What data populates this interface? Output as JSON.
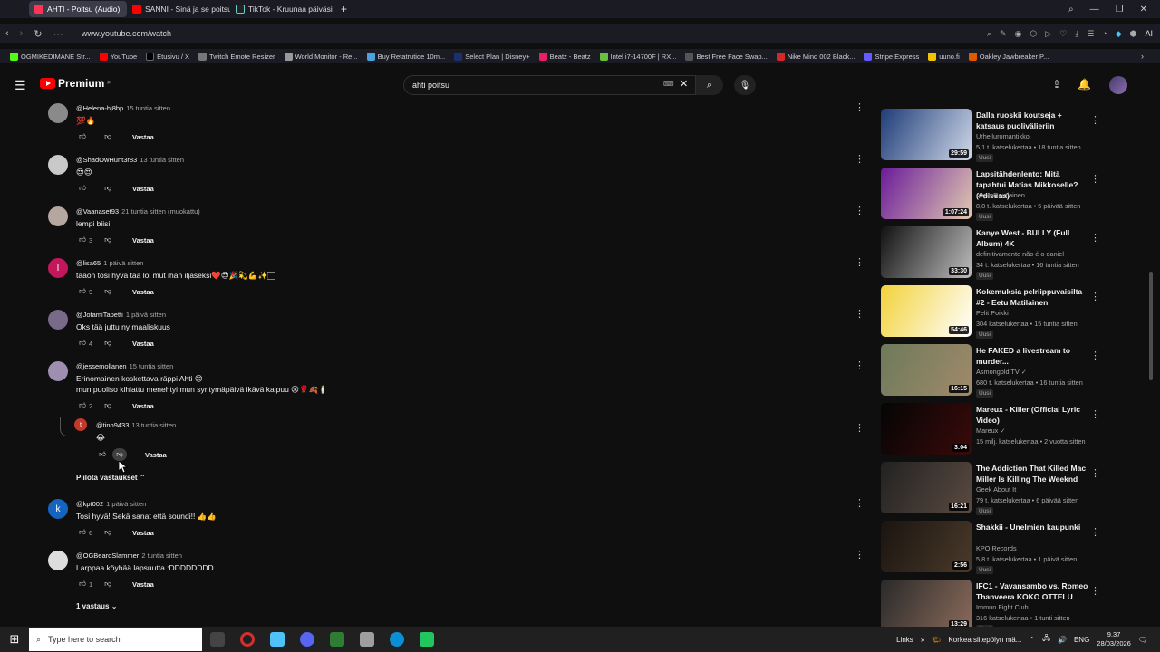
{
  "browser": {
    "tabs": [
      {
        "label": "AHTI - Poitsu (Audio)",
        "color": "#ff3355",
        "active": true
      },
      {
        "label": "SANNI - Sinä ja se poitsu",
        "color": "#ff0000",
        "active": false
      },
      {
        "label": "TikTok - Kruunaa päiväsi",
        "color": "#222222",
        "active": false
      }
    ],
    "new_tab": "+",
    "url": "www.youtube.com/watch",
    "bookmarks": [
      {
        "label": "OGMIKEDIMANE Str...",
        "color": "#53fc18"
      },
      {
        "label": "YouTube",
        "color": "#ff0000"
      },
      {
        "label": "Etusivu / X",
        "color": "#000000"
      },
      {
        "label": "Twitch Emote Resizer",
        "color": "#777777"
      },
      {
        "label": "World Monitor - Re...",
        "color": "#999999"
      },
      {
        "label": "Buy Retatrutide 10m...",
        "color": "#4aa3df"
      },
      {
        "label": "Select Plan | Disney+",
        "color": "#1d2f6f"
      },
      {
        "label": "Beatz - Beatz",
        "color": "#e91e63"
      },
      {
        "label": "Intel i7-14700F | RX...",
        "color": "#6abf40"
      },
      {
        "label": "Best Free Face Swap...",
        "color": "#555555"
      },
      {
        "label": "Nike Mind 002 Black...",
        "color": "#d62828"
      },
      {
        "label": "Stripe Express",
        "color": "#635bff"
      },
      {
        "label": "uuno.fi",
        "color": "#f5c400"
      },
      {
        "label": "Oakley Jawbreaker P...",
        "color": "#e05a00"
      }
    ]
  },
  "youtube": {
    "logo_text": "Premium",
    "logo_sup": "FI",
    "search_value": "ahti poitsu"
  },
  "comments": [
    {
      "author": "@Helena-hj8bp",
      "time": "15 tuntia sitten",
      "text": "💯🔥",
      "likes": "",
      "reply": "Vastaa",
      "avatar": "#8a8a8a",
      "initial": ""
    },
    {
      "author": "@ShadOwHunt3r83",
      "time": "13 tuntia sitten",
      "text": "😍😍",
      "likes": "",
      "reply": "Vastaa",
      "avatar": "#c9c9c9",
      "initial": ""
    },
    {
      "author": "@Vaanaset93",
      "time": "21 tuntia sitten (muokattu)",
      "text": "lempi biisi",
      "likes": "3",
      "reply": "Vastaa",
      "avatar": "#b5a7a0",
      "initial": ""
    },
    {
      "author": "@lisa65",
      "time": "1 päivä sitten",
      "text": "tääon tosi hyvä tää löi mut ihan iljaseksi❤️😍🎉💫💪✨🏻",
      "likes": "9",
      "reply": "Vastaa",
      "avatar": "#c2185b",
      "initial": "l"
    },
    {
      "author": "@JotamiTapetti",
      "time": "1 päivä sitten",
      "text": "Oks tää juttu ny maaliskuus",
      "likes": "4",
      "reply": "Vastaa",
      "avatar": "#7a6a8a",
      "initial": ""
    },
    {
      "author": "@jessemollanen",
      "time": "15 tuntia sitten",
      "text": "Erinomainen koskettava räppi Ahti 😊",
      "text2": "mun puoliso kihlattu menehtyi mun syntymäpäivä ikävä kaipuu 😢🌹🍂🕯️",
      "likes": "2",
      "reply": "Vastaa",
      "avatar": "#9e8fb0",
      "initial": ""
    },
    {
      "author": "@kpt002",
      "time": "1 päivä sitten",
      "text": "Tosi hyvä! Sekä sanat että soundi!! 👍👍",
      "likes": "6",
      "reply": "Vastaa",
      "avatar": "#1565c0",
      "initial": "k"
    },
    {
      "author": "@OGBeardSlammer",
      "time": "2 tuntia sitten",
      "text": "Larppaa köyhää lapsuutta :DDDDDDDD",
      "likes": "1",
      "reply": "Vastaa",
      "avatar": "#dddddd",
      "initial": ""
    }
  ],
  "reply_comment": {
    "author": "@tino9433",
    "time": "13 tuntia sitten",
    "text": "😂",
    "reply": "Vastaa",
    "avatar": "#c0392b",
    "initial": "t"
  },
  "hide_replies": "Piilota vastaukset",
  "one_reply": "1 vastaus",
  "videos": [
    {
      "title": "Dalla ruoskii koutseja + katsaus puolivälieriin",
      "channel": "Urheiluromantikko",
      "meta": "5,1 t. katselukertaa • 18 tuntia sitten",
      "badge": "Uusi",
      "duration": "29:59",
      "c1": "#1e3c78",
      "c2": "#cfd8e8"
    },
    {
      "title": "Lapsitähdenlento: Mitä tapahtui Matias Mikkoselle? (#dissaa)",
      "channel": "Aapo Rautiainen",
      "meta": "8,8 t. katselukertaa • 5 päivää sitten",
      "badge": "Uusi",
      "duration": "1:07:24",
      "c1": "#6a1b9a",
      "c2": "#e0c8b0"
    },
    {
      "title": "Kanye West - BULLY (Full Album) 4K",
      "channel": "definitivamente não é o daniel",
      "meta": "34 t. katselukertaa • 16 tuntia sitten",
      "badge": "Uusi",
      "duration": "33:30",
      "c1": "#111111",
      "c2": "#bdbdbd"
    },
    {
      "title": "Kokemuksia pelriippuvaisilta #2 - Eetu Matilainen",
      "channel": "Pelit Poikki",
      "meta": "304 katselukertaa • 15 tuntia sitten",
      "badge": "Uusi",
      "duration": "54:46",
      "c1": "#f2d23a",
      "c2": "#ffffff"
    },
    {
      "title": "He FAKED a livestream to murder...",
      "channel": "Asmongold TV ✓",
      "meta": "680 t. katselukertaa • 16 tuntia sitten",
      "badge": "Uusi",
      "duration": "16:15",
      "c1": "#6d7a5a",
      "c2": "#a08a6a"
    },
    {
      "title": "Mareux - Killer (Official Lyric Video)",
      "channel": "Mareux ✓",
      "meta": "15 milj. katselukertaa • 2 vuotta sitten",
      "badge": "",
      "duration": "3:04",
      "c1": "#050505",
      "c2": "#3a0a0a"
    },
    {
      "title": "The Addiction That Killed Mac Miller Is Killing The Weeknd",
      "channel": "Geek About It",
      "meta": "79 t. katselukertaa • 6 päivää sitten",
      "badge": "Uusi",
      "duration": "16:21",
      "c1": "#222222",
      "c2": "#5a4a40"
    },
    {
      "title": "Shakkii - Unelmien kaupunki",
      "channel": "KPO Records",
      "meta": "5,8 t. katselukertaa • 1 päivä sitten",
      "badge": "Uusi",
      "duration": "2:56",
      "c1": "#1a1410",
      "c2": "#4a3a2a"
    },
    {
      "title": "IFC1 - Vavansambo vs. Romeo Thanveera KOKO OTTELU",
      "channel": "Immun Fight Club",
      "meta": "316 katselukertaa • 1 tunti sitten",
      "badge": "Uusi",
      "duration": "13:29",
      "c1": "#2a2a2a",
      "c2": "#8a6a5a"
    }
  ],
  "taskbar": {
    "search_placeholder": "Type here to search",
    "links": "Links",
    "weather": "Korkea siitepölyn mä...",
    "lang": "ENG",
    "time": "9.37",
    "date": "28/03/2026",
    "apps": [
      {
        "name": "task-view",
        "color": "#444444"
      },
      {
        "name": "opera",
        "color": "#d32f2f"
      },
      {
        "name": "copilot",
        "color": "#4fc3f7"
      },
      {
        "name": "discord",
        "color": "#5865f2"
      },
      {
        "name": "app-green",
        "color": "#2e7d32"
      },
      {
        "name": "app-shield",
        "color": "#9e9e9e"
      },
      {
        "name": "edge",
        "color": "#0b8fd4"
      },
      {
        "name": "app-play",
        "color": "#22c55e"
      }
    ]
  }
}
